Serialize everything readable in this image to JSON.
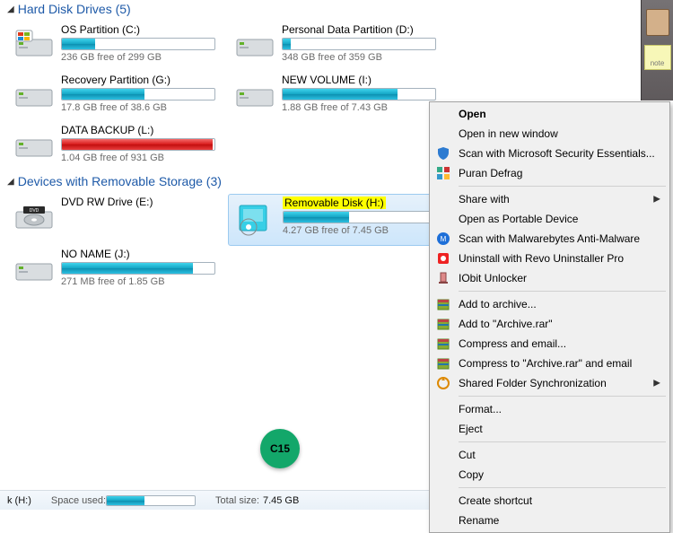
{
  "sections": {
    "hdd": {
      "title": "Hard Disk Drives (5)"
    },
    "removable": {
      "title": "Devices with Removable Storage (3)"
    }
  },
  "hdd": [
    {
      "name": "OS Partition (C:)",
      "free": "236 GB free of 299 GB",
      "pct": 22,
      "color": "blue"
    },
    {
      "name": "Personal Data Partition (D:)",
      "free": "348 GB free of 359 GB",
      "pct": 5,
      "color": "blue"
    },
    {
      "name": "Recovery Partition (G:)",
      "free": "17.8 GB free of 38.6 GB",
      "pct": 54,
      "color": "blue"
    },
    {
      "name": "NEW VOLUME (I:)",
      "free": "1.88 GB free of 7.43 GB",
      "pct": 75,
      "color": "blue"
    },
    {
      "name": "DATA BACKUP (L:)",
      "free": "1.04 GB free of 931 GB",
      "pct": 99,
      "color": "red"
    }
  ],
  "removable": [
    {
      "name": "DVD RW Drive (E:)",
      "free": "",
      "pct": null
    },
    {
      "name": "Removable Disk (H:)",
      "free": "4.27 GB free of 7.45 GB",
      "pct": 43,
      "highlight": true,
      "selected": true
    },
    {
      "name": "NO NAME (J:)",
      "free": "271 MB free of 1.85 GB",
      "pct": 86
    }
  ],
  "statusbar": {
    "drive": "k (H:)",
    "space_used_label": "Space used:",
    "space_used_pct": 43,
    "total_label": "Total size:",
    "total_value": "7.45 GB"
  },
  "badge": "C15",
  "desktop_note": "note",
  "context_menu": [
    {
      "label": "Open",
      "bold": true
    },
    {
      "label": "Open in new window"
    },
    {
      "label": "Scan with Microsoft Security Essentials...",
      "icon": "shield-blue"
    },
    {
      "label": "Puran Defrag",
      "icon": "defrag"
    },
    {
      "sep": true
    },
    {
      "label": "Share with",
      "submenu": true
    },
    {
      "label": "Open as Portable Device"
    },
    {
      "label": "Scan with Malwarebytes Anti-Malware",
      "icon": "mbam"
    },
    {
      "label": "Uninstall with Revo Uninstaller Pro",
      "icon": "revo"
    },
    {
      "label": "IObit Unlocker",
      "icon": "iobit"
    },
    {
      "sep": true
    },
    {
      "label": "Add to archive...",
      "icon": "rar"
    },
    {
      "label": "Add to \"Archive.rar\"",
      "icon": "rar"
    },
    {
      "label": "Compress and email...",
      "icon": "rar"
    },
    {
      "label": "Compress to \"Archive.rar\" and email",
      "icon": "rar"
    },
    {
      "label": "Shared Folder Synchronization",
      "icon": "sync",
      "submenu": true
    },
    {
      "sep": true
    },
    {
      "label": "Format..."
    },
    {
      "label": "Eject"
    },
    {
      "sep": true
    },
    {
      "label": "Cut"
    },
    {
      "label": "Copy"
    },
    {
      "sep": true
    },
    {
      "label": "Create shortcut"
    },
    {
      "label": "Rename"
    }
  ]
}
